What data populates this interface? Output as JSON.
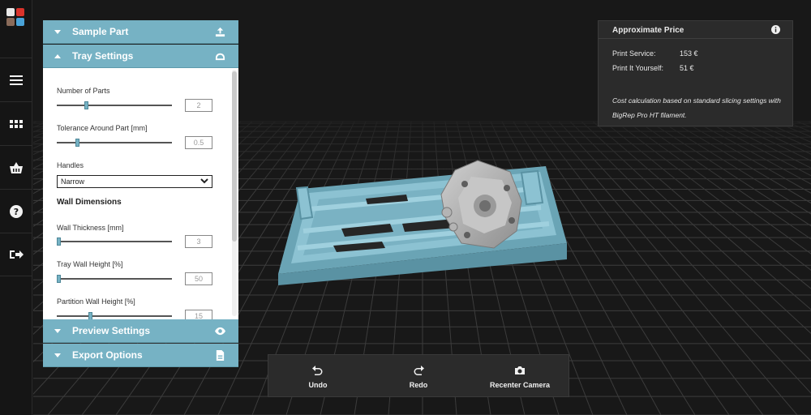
{
  "panel": {
    "sample_part": "Sample Part",
    "tray_settings": "Tray Settings",
    "fields": [
      {
        "label": "Number of Parts",
        "value": "2"
      },
      {
        "label": "Tolerance Around Part [mm]",
        "value": "0.5"
      }
    ],
    "handles_label": "Handles",
    "handles_value": "Narrow",
    "wall_dimensions": "Wall Dimensions",
    "wall_fields": [
      {
        "label": "Wall Thickness [mm]",
        "value": "3"
      },
      {
        "label": "Tray Wall Height [%]",
        "value": "50"
      },
      {
        "label": "Partition Wall Height [%]",
        "value": "15"
      }
    ],
    "preview_settings": "Preview Settings",
    "export_options": "Export Options"
  },
  "price": {
    "title": "Approximate Price",
    "service_label": "Print Service:",
    "service_value": "153 €",
    "yourself_label": "Print It Yourself:",
    "yourself_value": "51 €",
    "note": "Cost calculation based on standard slicing settings with BigRep Pro HT filament."
  },
  "toolbar": {
    "undo": "Undo",
    "redo": "Redo",
    "recenter": "Recenter Camera"
  },
  "colors": {
    "accent": "#76b2c4",
    "tray": "#7fb6c6",
    "part": "#a9a9a9",
    "logo": [
      "#e8e8e8",
      "#d9332b",
      "#8a6b5a",
      "#4aa3d8"
    ]
  },
  "icons": [
    "logo",
    "menu-icon",
    "grid-icon",
    "basket-icon",
    "help-icon",
    "logout-icon",
    "upload-icon",
    "tray-icon",
    "eye-icon",
    "file-icon",
    "info-icon",
    "undo-icon",
    "redo-icon",
    "camera-icon"
  ]
}
